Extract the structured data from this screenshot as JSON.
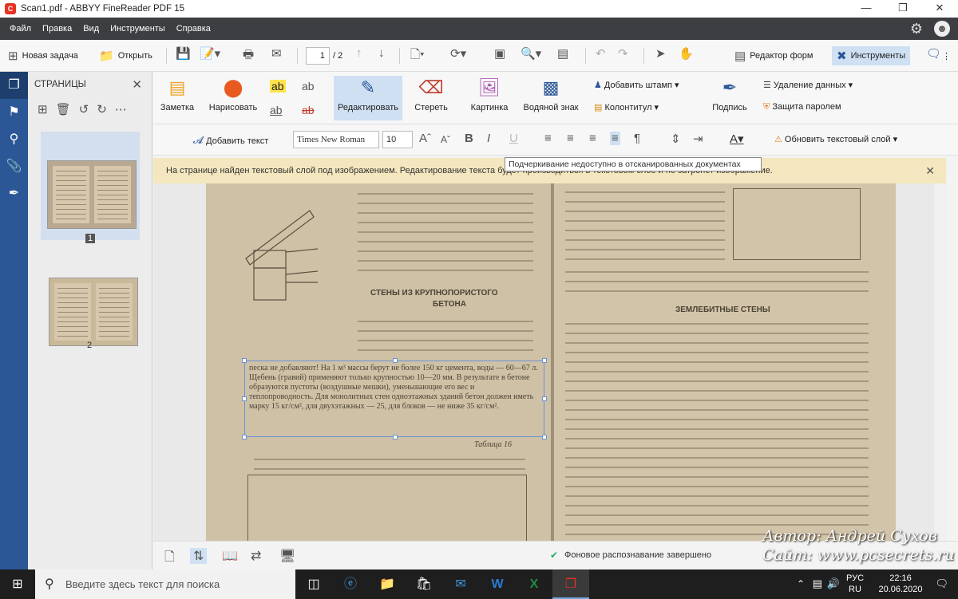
{
  "window": {
    "title": "Scan1.pdf - ABBYY FineReader PDF 15",
    "logo_letter": "C"
  },
  "menu": [
    "Файл",
    "Правка",
    "Вид",
    "Инструменты",
    "Справка"
  ],
  "toolbar": {
    "new_task": "Новая задача",
    "open": "Открыть",
    "page_current": "1",
    "page_total": "/ 2",
    "form_editor": "Редактор форм",
    "tools": "Инструменты"
  },
  "pages_panel": {
    "header": "СТРАНИЦЫ",
    "page1": "1",
    "page2": "2"
  },
  "ribbon": {
    "note": "Заметка",
    "draw": "Нарисовать",
    "edit": "Редактировать",
    "erase": "Стереть",
    "picture": "Картинка",
    "watermark": "Водяной знак",
    "add_stamp": "Добавить штамп",
    "header_footer": "Колонтитул",
    "signature": "Подпись",
    "remove_data": "Удаление данных",
    "password": "Защита паролем"
  },
  "format_bar": {
    "add_text": "Добавить текст",
    "font": "Times New Roman",
    "size": "10",
    "update_layer": "Обновить текстовый слой"
  },
  "tooltip": "Подчеркивание недоступно в отсканированных документах",
  "notification": "На странице найден текстовый слой под изображением. Редактирование текста будет производиться в текстовом слое и не затронет изображение.",
  "scan": {
    "left_heading": "СТЕНЫ ИЗ КРУПНОПОРИСТОГО",
    "left_heading2": "БЕТОНА",
    "table_caption": "Таблица 16",
    "right_heading": "ЗЕМЛЕБИТНЫЕ СТЕНЫ",
    "selected_text": "песка не добавляют! На 1 м³ массы берут не более 150 кг цемента, воды — 60—67 л. Щебень (гравий) применяют только крупностью 10—20 мм. В результате в бетоне образуются пустоты (воздушные мешки), уменьшающие его вес и теплопроводность. Для монолитных стен одноэтажных зданий бетон должен иметь марку 15 кг/см², для двухэтажных — 25, для блоков — не ниже 35 кг/см²."
  },
  "status": {
    "text": "Фоновое распознавание завершено"
  },
  "watermark": {
    "line1": "Автор: Андрей Сухов",
    "line2": "Сайт: www.pcsecrets.ru"
  },
  "taskbar": {
    "search_placeholder": "Введите здесь текст для поиска",
    "lang1": "РУС",
    "lang2": "RU",
    "time": "22:16",
    "date": "20.06.2020"
  },
  "colors": {
    "rail": "#2b5797",
    "menubar": "#3d3e42",
    "notification": "#f4e7bf",
    "selection": "#6b93d6"
  }
}
